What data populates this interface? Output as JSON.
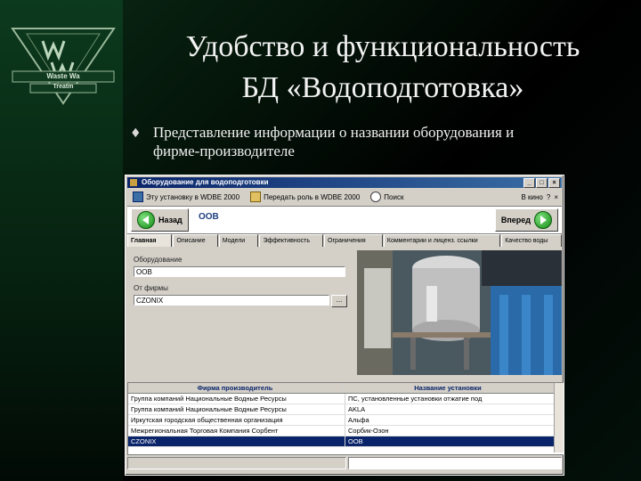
{
  "slide": {
    "title_line1": "Удобство и функциональность",
    "title_line2": "БД «Водоподготовка»",
    "bullet_icon": "diamond-bullet-icon",
    "bullet_line1": "Представление информации о названии оборудования и",
    "bullet_line2": "фирме-производителе"
  },
  "logo": {
    "text_top": "Waste Wa",
    "text_bottom": "Treatm"
  },
  "window": {
    "title": "Оборудование для водоподготовки",
    "menu": [
      "Эту установку в WDBE 2000",
      "Передать роль в WDBE 2000",
      "Поиск",
      "В кино"
    ],
    "menu_question": "?",
    "back_label": "Назад",
    "forward_label": "Вперед",
    "record_code": "ООВ",
    "tabs": [
      "Главная",
      "Описание",
      "Модели",
      "Эффективность",
      "Ограничения",
      "Комментарии и лиценз. ссылки",
      "Качество воды"
    ],
    "equipment_label": "Оборудование",
    "equipment_value": "ООВ",
    "firm_label": "От фирмы",
    "firm_value": "CZONIX",
    "browse_label": "...",
    "grid": {
      "headers": [
        "Фирма производитель",
        "Название установки"
      ],
      "rows": [
        [
          "Группа компаний Национальные Водные Ресурсы",
          "ПС, установленные установки отжатие под"
        ],
        [
          "Группа компаний Национальные Водные Ресурсы",
          "AKLA"
        ],
        [
          "Иркутская городская общественная организация",
          "Альфа"
        ],
        [
          "Межрегиональная Торговая Компания Сорбент",
          "Сорбик-Озон"
        ],
        [
          "CZONIX",
          "ООВ"
        ]
      ],
      "selected_row": 4
    }
  },
  "colors": {
    "title_bar": "#0a246a",
    "accent_green": "#128a12",
    "background": "#000000"
  }
}
